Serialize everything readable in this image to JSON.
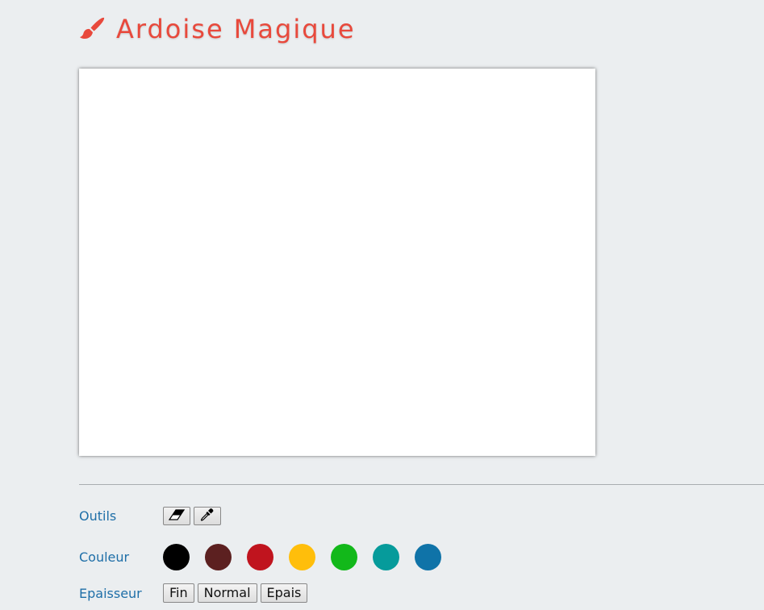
{
  "header": {
    "title": "Ardoise Magique",
    "title_color": "#e8493c",
    "icon": "paint-brush-icon"
  },
  "canvas": {
    "background": "#ffffff"
  },
  "tools": {
    "label": "Outils",
    "items": [
      {
        "name": "eraser",
        "icon": "eraser-icon"
      },
      {
        "name": "eyedropper",
        "icon": "eyedropper-icon"
      }
    ]
  },
  "colors": {
    "label": "Couleur",
    "swatches": [
      "#000000",
      "#5c2020",
      "#c0141e",
      "#ffbe0b",
      "#12b81a",
      "#069b9b",
      "#0f73a8"
    ]
  },
  "sizes": {
    "label": "Epaisseur",
    "options": [
      "Fin",
      "Normal",
      "Epais"
    ]
  }
}
